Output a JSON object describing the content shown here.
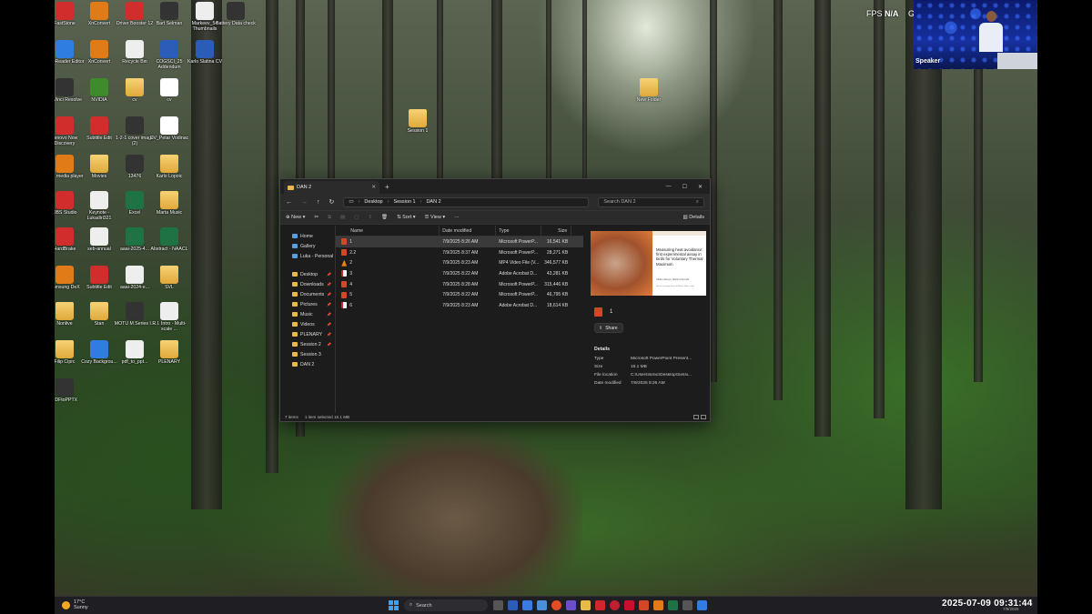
{
  "overlay": {
    "fps_label": "FPS",
    "fps_value": "N/A",
    "extra_letter": "G",
    "speaker_label": "Speaker"
  },
  "desktop_icons": [
    {
      "label": "FastStone",
      "style": "red"
    },
    {
      "label": "XnConvert",
      "style": "orange"
    },
    {
      "label": "Driver Booster 12",
      "style": "red"
    },
    {
      "label": "Bart Selman",
      "style": "dark"
    },
    {
      "label": "Markeev_54 Thumbnails",
      "style": "white"
    },
    {
      "label": "Battery Data check",
      "style": "dark"
    },
    {
      "label": "CADReader Editor",
      "style": "blue"
    },
    {
      "label": "XnConvert",
      "style": "orange"
    },
    {
      "label": "Recycle Bin",
      "style": "white"
    },
    {
      "label": "COGSCI_25 Addendum",
      "style": "word"
    },
    {
      "label": "Karlo Slatina CV",
      "style": "word"
    },
    {
      "label": "DaVinci Resolve",
      "style": "dark"
    },
    {
      "label": "NVIDIA",
      "style": "green"
    },
    {
      "label": "cv",
      "style": "folder"
    },
    {
      "label": "cv",
      "style": "pdf"
    },
    {
      "label": "Lenovo Now Discovery",
      "style": "red"
    },
    {
      "label": "Subtitle Edit",
      "style": "red"
    },
    {
      "label": "1-2-1 cover image (2)",
      "style": "dark"
    },
    {
      "label": "CV_Petar Vodinac",
      "style": "pdf"
    },
    {
      "label": "VLC media player",
      "style": "orange"
    },
    {
      "label": "Movies",
      "style": "folder"
    },
    {
      "label": "13476",
      "style": "dark"
    },
    {
      "label": "Karlo Lopoic",
      "style": "folder"
    },
    {
      "label": "OBS Studio",
      "style": "red"
    },
    {
      "label": "Keynote - Lukadirl321",
      "style": "white"
    },
    {
      "label": "Excel",
      "style": "excel"
    },
    {
      "label": "Marta Music",
      "style": "folder"
    },
    {
      "label": "HardBrake",
      "style": "red"
    },
    {
      "label": "seb-annual",
      "style": "white"
    },
    {
      "label": "aaai-2025-4...",
      "style": "excel"
    },
    {
      "label": "Abstract - NAACL",
      "style": "excel"
    },
    {
      "label": "Samsung DeX",
      "style": "orange"
    },
    {
      "label": "Subtitle Edit",
      "style": "red"
    },
    {
      "label": "aaai-2024-e...",
      "style": "white"
    },
    {
      "label": "SVL",
      "style": "folder"
    },
    {
      "label": "Nonlive",
      "style": "folder"
    },
    {
      "label": "Stan",
      "style": "folder"
    },
    {
      "label": "MOTU M Series I...",
      "style": "dark"
    },
    {
      "label": "R.I. Intro - Multi-scale ...",
      "style": "white"
    },
    {
      "label": "Filip Ciprc",
      "style": "folder"
    },
    {
      "label": "Cozy Backgrou...",
      "style": "blue"
    },
    {
      "label": "pdf_to_ppt...",
      "style": "white"
    },
    {
      "label": "PLENARY",
      "style": "folder"
    },
    {
      "label": "PDFtoPPTX",
      "style": "dark"
    },
    {
      "label": "Session 1",
      "style": "folder"
    },
    {
      "label": "New Folder",
      "style": "folder"
    }
  ],
  "explorer": {
    "tab_title": "DAN 2",
    "new_tab": "+",
    "breadcrumb": [
      "Desktop",
      "Session 1",
      "DAN 2"
    ],
    "search_placeholder": "Search DAN 2",
    "cmd": {
      "new": "New",
      "sort": "Sort",
      "view": "View",
      "more": "···",
      "details": "Details"
    },
    "nav": [
      {
        "label": "Home"
      },
      {
        "label": "Gallery"
      },
      {
        "label": "Luka - Personal"
      },
      {
        "label": "Desktop"
      },
      {
        "label": "Downloads"
      },
      {
        "label": "Documents"
      },
      {
        "label": "Pictures"
      },
      {
        "label": "Music"
      },
      {
        "label": "Videos"
      },
      {
        "label": "PLENARY"
      },
      {
        "label": "Session 2"
      },
      {
        "label": "Session 3"
      },
      {
        "label": "DAN 2"
      }
    ],
    "columns": {
      "name": "Name",
      "date": "Date modified",
      "type": "Type",
      "size": "Size"
    },
    "files": [
      {
        "name": "1",
        "date": "7/9/2025 8:26 AM",
        "type": "Microsoft PowerP...",
        "size": "16,541 KB",
        "icon": "ppt"
      },
      {
        "name": "2.2",
        "date": "7/9/2025 8:37 AM",
        "type": "Microsoft PowerP...",
        "size": "28,271 KB",
        "icon": "ppt"
      },
      {
        "name": "2",
        "date": "7/9/2025 8:23 AM",
        "type": "MP4 Video File (V...",
        "size": "346,577 KB",
        "icon": "vlc"
      },
      {
        "name": "3",
        "date": "7/9/2025 8:22 AM",
        "type": "Adobe Acrobat D...",
        "size": "43,281 KB",
        "icon": "pdf"
      },
      {
        "name": "4",
        "date": "7/9/2025 8:28 AM",
        "type": "Microsoft PowerP...",
        "size": "315,446 KB",
        "icon": "ppt"
      },
      {
        "name": "5",
        "date": "7/9/2025 8:22 AM",
        "type": "Microsoft PowerP...",
        "size": "46,795 KB",
        "icon": "ppt"
      },
      {
        "name": "6",
        "date": "7/9/2025 8:23 AM",
        "type": "Adobe Acrobat D...",
        "size": "18,614 KB",
        "icon": "pdf"
      }
    ],
    "preview": {
      "slide_title": "Measuring heat avoidance: first experimental assay in birds for Voluntary Thermal Maximum",
      "slide_authors": "Addisu Elsayo, Martina Mercelli",
      "slide_affiliation": "Università degli Studi di Milano, Milan, Italy",
      "file_name": "1",
      "share": "Share",
      "details_heading": "Details",
      "details": [
        {
          "k": "Type",
          "v": "Microsoft PowerPoint Present..."
        },
        {
          "k": "Size",
          "v": "16.1 MB"
        },
        {
          "k": "File location",
          "v": "C:\\Users\\simic\\Desktop\\Sessi..."
        },
        {
          "k": "Date modified",
          "v": "7/9/2025 8:26 AM"
        }
      ]
    },
    "status": {
      "items": "7 items",
      "selected": "1 item selected  16.1 MB"
    }
  },
  "taskbar": {
    "temp": "17°C",
    "weather": "Sunny",
    "search": "Search",
    "clock": "2025-07-09 09:31:44",
    "clock_small": "7/9/2025"
  }
}
